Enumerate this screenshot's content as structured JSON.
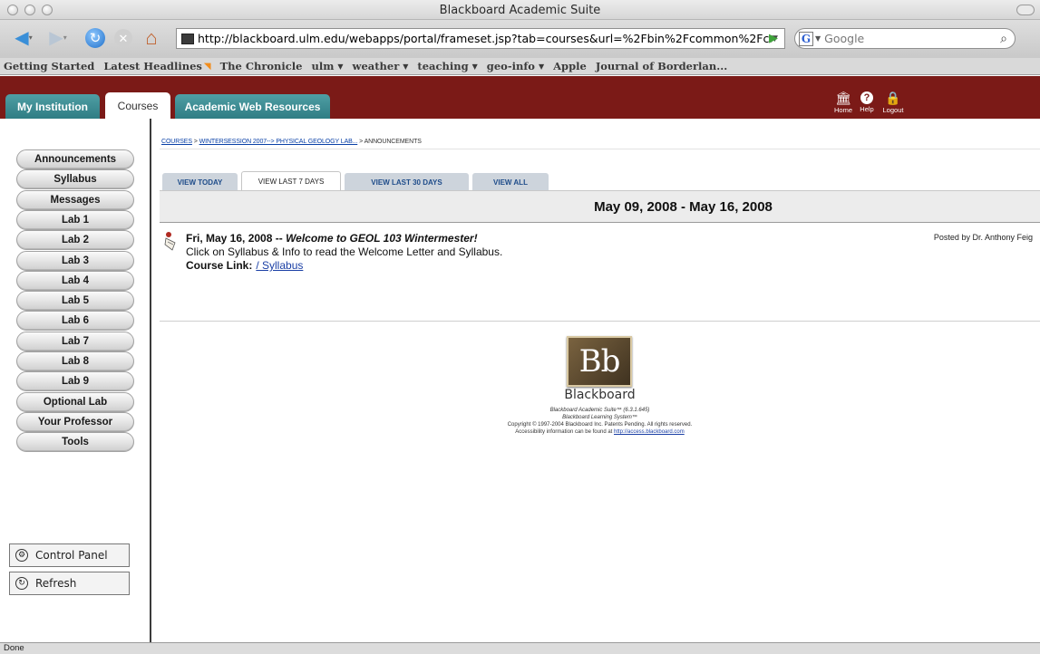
{
  "window": {
    "title": "Blackboard Academic Suite"
  },
  "browser": {
    "url": "http://blackboard.ulm.edu/webapps/portal/frameset.jsp?tab=courses&url=%2Fbin%2Fcommon%2Fcourse.p",
    "search_placeholder": "Google",
    "bookmarks": [
      {
        "label": "Getting Started",
        "has_menu": false,
        "rss": false
      },
      {
        "label": "Latest Headlines",
        "has_menu": false,
        "rss": true
      },
      {
        "label": "The Chronicle",
        "has_menu": false,
        "rss": false
      },
      {
        "label": "ulm",
        "has_menu": true,
        "rss": false
      },
      {
        "label": "weather",
        "has_menu": true,
        "rss": false
      },
      {
        "label": "teaching",
        "has_menu": true,
        "rss": false
      },
      {
        "label": "geo-info",
        "has_menu": true,
        "rss": false
      },
      {
        "label": "Apple",
        "has_menu": false,
        "rss": false
      },
      {
        "label": "Journal of Borderlan...",
        "has_menu": false,
        "rss": false
      }
    ],
    "status": "Done"
  },
  "header": {
    "tabs": {
      "institution": "My Institution",
      "courses": "Courses",
      "resources": "Academic Web Resources"
    },
    "icons": {
      "home": "Home",
      "help": "Help",
      "logout": "Logout"
    }
  },
  "sidebar": {
    "menu": [
      "Announcements",
      "Syllabus",
      "Messages",
      "Lab 1",
      "Lab 2",
      "Lab 3",
      "Lab 4",
      "Lab 5",
      "Lab 6",
      "Lab 7",
      "Lab 8",
      "Lab 9",
      "Optional Lab",
      "Your Professor",
      "Tools"
    ],
    "control_panel": "Control Panel",
    "refresh": "Refresh"
  },
  "main": {
    "breadcrumb": {
      "courses": "COURSES",
      "sep1": " > ",
      "course": "WINTERSESSION 2007--> PHYSICAL GEOLOGY LAB...",
      "sep2": " > ",
      "current": "ANNOUNCEMENTS"
    },
    "view_tabs": {
      "today": "VIEW TODAY",
      "last7": "VIEW LAST 7 DAYS",
      "last30": "VIEW LAST 30 DAYS",
      "all": "VIEW ALL"
    },
    "date_range": "May 09, 2008 - May 16, 2008",
    "announcement": {
      "date": "Fri, May 16, 2008 -- ",
      "subject": "Welcome to GEOL 103 Wintermester!",
      "body": "Click on Syllabus & Info to read the Welcome Letter and Syllabus.",
      "link_label": "Course Link:",
      "link_text": "/ Syllabus",
      "posted_by": "Posted by Dr. Anthony Feig"
    }
  },
  "footer": {
    "logo_letters": "Bb",
    "brand": "Blackboard",
    "line1": "Blackboard Academic Suite™ (6.3.1.645)",
    "line2": "Blackboard Learning System™",
    "line3": "Copyright © 1997-2004 Blackboard Inc. Patents Pending. All rights reserved.",
    "line4_prefix": "Accessibility information can be found at ",
    "line4_link": "http://access.blackboard.com"
  }
}
